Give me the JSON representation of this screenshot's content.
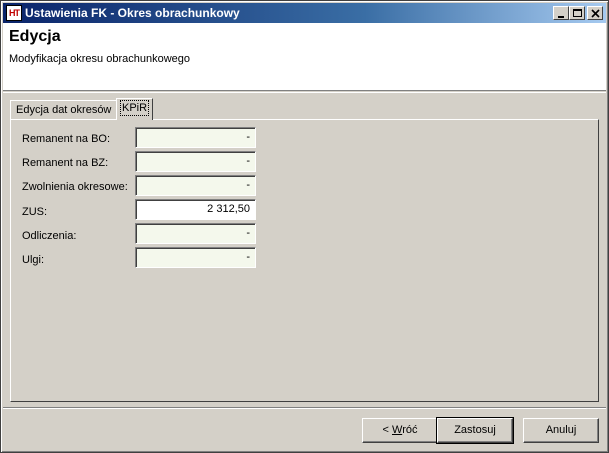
{
  "window": {
    "icon_text": "HT",
    "title": "Ustawienia FK - Okres obrachunkowy"
  },
  "header": {
    "title": "Edycja",
    "subtitle": "Modyfikacja okresu obrachunkowego"
  },
  "tabs": [
    {
      "label": "Edycja dat okresów",
      "active": false
    },
    {
      "label": "KPiR",
      "active": true
    }
  ],
  "fields": [
    {
      "label": "Remanent na BO:",
      "value": "-"
    },
    {
      "label": "Remanent na BZ:",
      "value": "-"
    },
    {
      "label": "Zwolnienia okresowe:",
      "value": "-"
    },
    {
      "label": "ZUS:",
      "value": "2 312,50"
    },
    {
      "label": "Odliczenia:",
      "value": "-"
    },
    {
      "label": "Ulgi:",
      "value": "-"
    }
  ],
  "buttons": {
    "back_prefix": "< ",
    "back_mnemonic": "W",
    "back_rest": "róć",
    "apply": "Zastosuj",
    "cancel": "Anuluj"
  }
}
